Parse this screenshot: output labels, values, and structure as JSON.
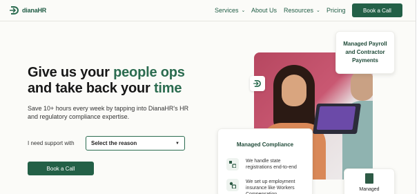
{
  "header": {
    "logo_text": "dianaHR",
    "nav": [
      {
        "label": "Services",
        "has_dropdown": true
      },
      {
        "label": "About Us",
        "has_dropdown": false
      },
      {
        "label": "Resources",
        "has_dropdown": true
      },
      {
        "label": "Pricing",
        "has_dropdown": false
      }
    ],
    "cta_label": "Book a Call"
  },
  "hero": {
    "headline_part1": "Give us your ",
    "headline_accent1": "people ops",
    "headline_part2": "and take back your ",
    "headline_accent2": "time",
    "subtext": "Save 10+ hours every week by tapping into DianaHR's HR and regulatory compliance expertise.",
    "support_label": "I need support with",
    "select_value": "Select the reason",
    "cta_label": "Book a Call"
  },
  "cards": {
    "payroll": "Managed Payroll and Contractor Payments",
    "compliance": {
      "title": "Managed Compliance",
      "items": [
        "We handle state registrations end-to-end",
        "We set up employment insurance like Workers Compensation"
      ]
    },
    "managed": "Managed"
  },
  "colors": {
    "brand_green": "#236047",
    "accent_green": "#2a6b4f",
    "photo_bg": "#c95872"
  }
}
